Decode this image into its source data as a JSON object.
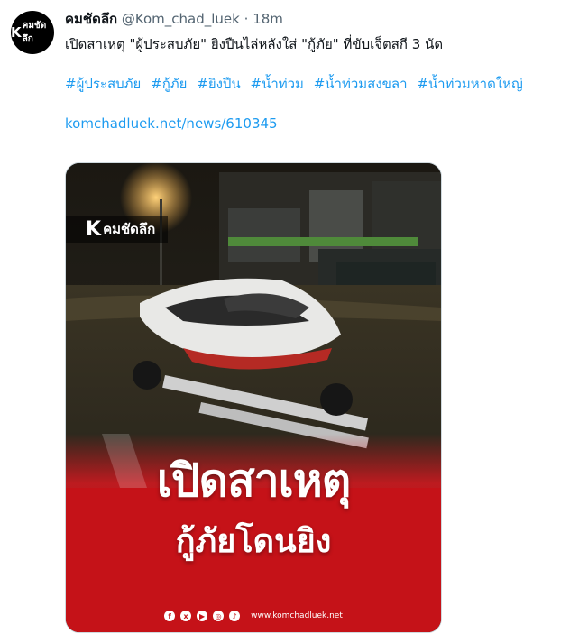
{
  "tweet": {
    "avatar_text": "คมชัดลึก",
    "avatar_k": "K",
    "display_name": "คมชัดลึก",
    "handle": "@Kom_chad_luek",
    "separator": "·",
    "time": "18m",
    "text": "เปิดสาเหตุ \"ผู้ประสบภัย\" ยิงปืนไล่หลังใส่ \"กู้ภัย\" ที่ขับเจ็ตสกี 3 นัด",
    "hashtags": [
      "#ผู้ประสบภัย",
      "#กู้ภัย",
      "#ยิงปืน",
      "#น้ำท่วม",
      "#น้ำท่วมสงขลา",
      "#น้ำท่วมหาดใหญ่"
    ],
    "link": "komchadluek.net/news/610345"
  },
  "media": {
    "brand_k": "K",
    "brand_text": "คมชัดลึก",
    "headline_1": "เปิดสาเหตุ",
    "headline_2": "กู้ภัยโดนยิง",
    "social_icons": [
      "f",
      "x",
      "▶",
      "◎",
      "♪"
    ],
    "social_icon_names": [
      "facebook-icon",
      "x-icon",
      "youtube-icon",
      "instagram-icon",
      "tiktok-icon"
    ],
    "site_url": "www.komchadluek.net",
    "accent_color": "#d71920"
  }
}
